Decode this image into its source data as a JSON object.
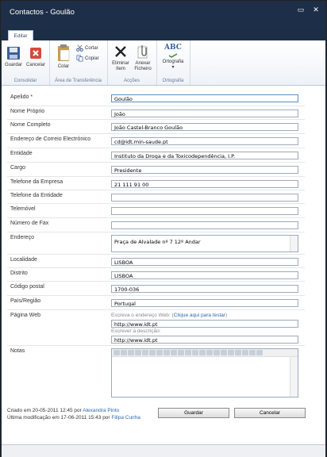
{
  "window": {
    "title": "Contactos - Goulão",
    "min_glyph": "▭",
    "close_glyph": "✕"
  },
  "ribbon": {
    "tab": "Editar",
    "groups": [
      {
        "label": "Consolidar"
      },
      {
        "label": "Área de Transferência"
      },
      {
        "label": "Acções"
      },
      {
        "label": "Ortografia"
      }
    ],
    "buttons": {
      "save": "Guardar",
      "cancel": "Cancelar",
      "paste": "Colar",
      "cut": "Cortar",
      "copy": "Copiar",
      "delete_line1": "Eliminar",
      "delete_line2": "Item",
      "attach_line1": "Anexar",
      "attach_line2": "Ficheiro",
      "spelling": "Ortografia",
      "spelling_arrow": "▾",
      "spelling_icon_text": "ABC"
    }
  },
  "form": {
    "apelido": {
      "label": "Apelido",
      "required_mark": "*",
      "value": "Goulão"
    },
    "nome_proprio": {
      "label": "Nome Próprio",
      "value": "João"
    },
    "nome_completo": {
      "label": "Nome Completo",
      "value": "João Castel-Branco Goulão"
    },
    "email": {
      "label": "Endereço de Correio Electrónico",
      "value": "cd@idt.min-saude.pt"
    },
    "entidade": {
      "label": "Entidade",
      "value": "Instituto da Droga e da Toxicodependência, I.P."
    },
    "cargo": {
      "label": "Cargo",
      "value": "Presidente"
    },
    "tel_empresa": {
      "label": "Telefone da Empresa",
      "value": "21 111 91 00"
    },
    "tel_entidade": {
      "label": "Telefone da Entidade",
      "value": ""
    },
    "telemovel": {
      "label": "Telemóvel",
      "value": ""
    },
    "fax": {
      "label": "Número de Fax",
      "value": ""
    },
    "endereco": {
      "label": "Endereço",
      "value": "Praça de Alvalade nº 7 12º Andar"
    },
    "localidade": {
      "label": "Localidade",
      "value": "LISBOA"
    },
    "distrito": {
      "label": "Distrito",
      "value": "LISBOA"
    },
    "codigo_postal": {
      "label": "Código postal",
      "value": "1700-036"
    },
    "pais": {
      "label": "País/Região",
      "value": "Portugal"
    },
    "pagina_web": {
      "label": "Página Web",
      "hint_address": "Escreva o endereço Web:",
      "hint_link": "Clique aqui para testar",
      "hint_paren_open": "(",
      "hint_paren_close": ")",
      "url": "http://www.idt.pt",
      "hint_desc": "Escrever a descrição:",
      "description": "http://www.idt.pt"
    },
    "notas": {
      "label": "Notas",
      "value": ""
    }
  },
  "footer": {
    "created_prefix": "Criado em 20-05-2011 12:45 por",
    "created_by": "Alexandra Pinto",
    "modified_prefix": "Última modificação em 17-06-2011 15:43 por",
    "modified_by": "Filipa Cunha",
    "save_button": "Guardar",
    "cancel_button": "Cancelar"
  },
  "status_bar": {
    "text": ""
  }
}
